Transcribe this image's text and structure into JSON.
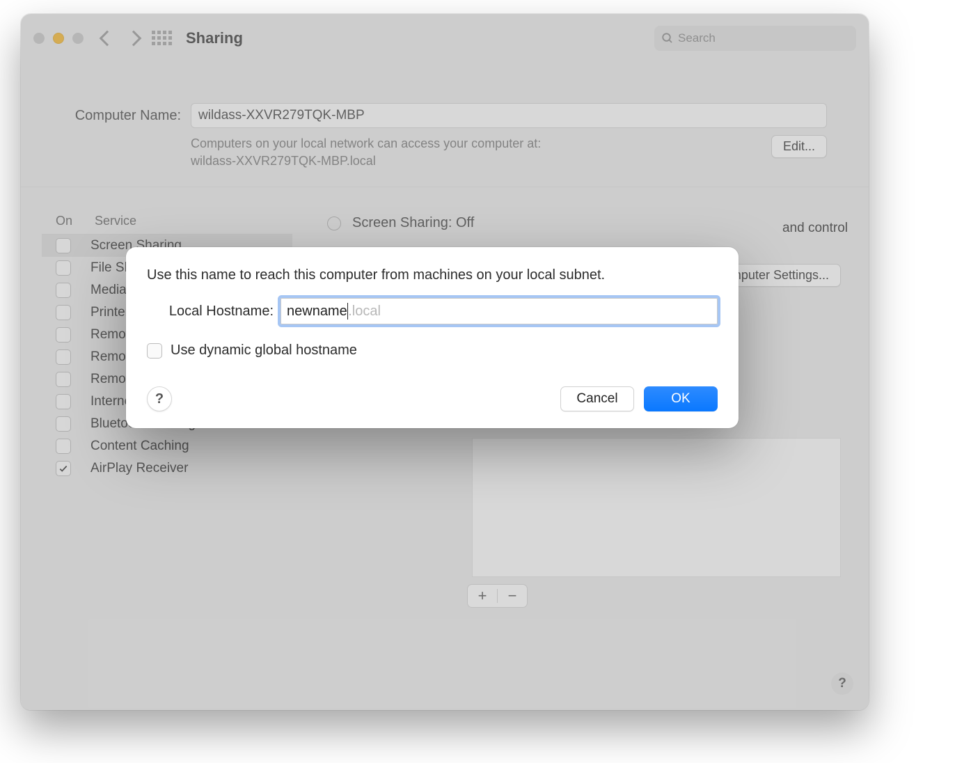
{
  "toolbar": {
    "title": "Sharing",
    "search_placeholder": "Search"
  },
  "computer_name": {
    "label": "Computer Name:",
    "value": "wildass-XXVR279TQK-MBP",
    "hint_line1": "Computers on your local network can access your computer at:",
    "hint_line2": "wildass-XXVR279TQK-MBP.local",
    "edit_label": "Edit..."
  },
  "sidebar": {
    "on_header": "On",
    "service_header": "Service",
    "items": [
      {
        "label": "Screen Sharing",
        "checked": false,
        "selected": true
      },
      {
        "label": "File Sharing",
        "checked": false,
        "selected": false
      },
      {
        "label": "Media Sharing",
        "checked": false,
        "selected": false
      },
      {
        "label": "Printer Sharing",
        "checked": false,
        "selected": false
      },
      {
        "label": "Remote Login",
        "checked": false,
        "selected": false
      },
      {
        "label": "Remote Management",
        "checked": false,
        "selected": false
      },
      {
        "label": "Remote Apple Events",
        "checked": false,
        "selected": false
      },
      {
        "label": "Internet Sharing",
        "checked": false,
        "selected": false
      },
      {
        "label": "Bluetooth Sharing",
        "checked": false,
        "selected": false
      },
      {
        "label": "Content Caching",
        "checked": false,
        "selected": false
      },
      {
        "label": "AirPlay Receiver",
        "checked": true,
        "selected": false
      }
    ]
  },
  "detail": {
    "status": "Screen Sharing: Off",
    "and_control": "and control",
    "computer_settings": "Computer Settings..."
  },
  "dialog": {
    "message": "Use this name to reach this computer from machines on your local subnet.",
    "hostname_label": "Local Hostname:",
    "hostname_value": "newname",
    "hostname_suffix": ".local",
    "dynamic_label": "Use dynamic global hostname",
    "dynamic_checked": false,
    "cancel": "Cancel",
    "ok": "OK"
  },
  "help_glyph": "?"
}
